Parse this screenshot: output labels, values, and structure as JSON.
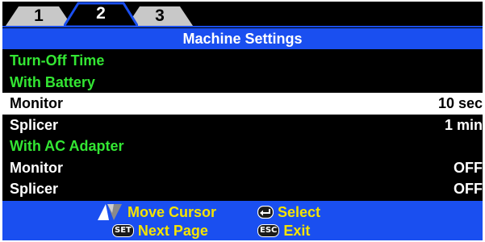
{
  "tabs": [
    {
      "label": "1",
      "active": false
    },
    {
      "label": "2",
      "active": true
    },
    {
      "label": "3",
      "active": false
    }
  ],
  "title": "Machine Settings",
  "rows": [
    {
      "label": "Turn-Off Time",
      "value": "",
      "kind": "heading"
    },
    {
      "label": "With Battery",
      "value": "",
      "kind": "heading"
    },
    {
      "label": "Monitor",
      "value": "10 sec",
      "kind": "item",
      "selected": true
    },
    {
      "label": "Splicer",
      "value": "1 min",
      "kind": "item"
    },
    {
      "label": "With AC Adapter",
      "value": "",
      "kind": "heading"
    },
    {
      "label": "Monitor",
      "value": "OFF",
      "kind": "item"
    },
    {
      "label": "Splicer",
      "value": "OFF",
      "kind": "item"
    }
  ],
  "footer": {
    "move_cursor": "Move Cursor",
    "select": "Select",
    "next_page": "Next Page",
    "exit": "Exit",
    "set_key": "SET",
    "esc_key": "ESC"
  },
  "colors": {
    "accent_blue": "#1a4ff0",
    "heading_green": "#33e633",
    "hint_yellow": "#f5e400",
    "tab_gray": "#c8c8c8"
  },
  "icons": {
    "move_cursor": "up-down-arrows-icon",
    "select": "enter-icon",
    "next_page": "set-key-icon",
    "exit": "esc-key-icon"
  }
}
